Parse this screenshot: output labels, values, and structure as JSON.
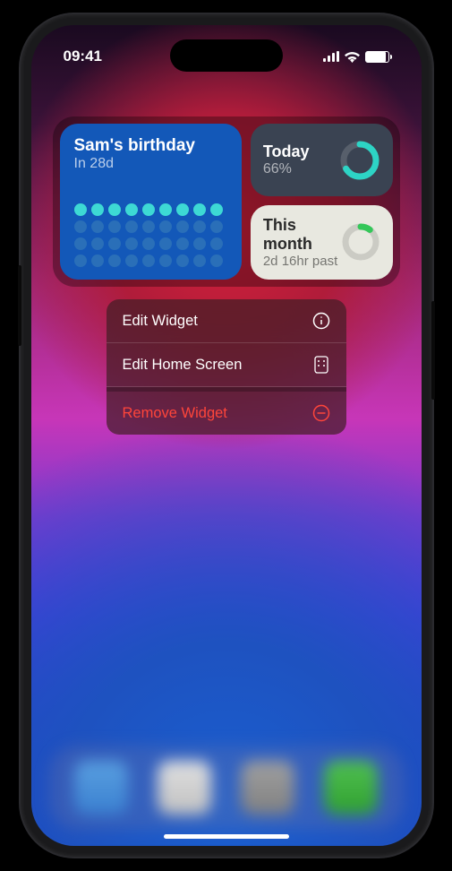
{
  "status": {
    "time": "09:41"
  },
  "widgets": {
    "countdown": {
      "title": "Sam's birthday",
      "subtitle": "In 28d"
    },
    "today": {
      "title": "Today",
      "value": "66%",
      "ring_color": "#2dd4c5",
      "ring_pct": 66
    },
    "month": {
      "title": "This month",
      "value": "2d 16hr past",
      "ring_color": "#34c759",
      "ring_pct": 10
    }
  },
  "menu": {
    "edit_widget": "Edit Widget",
    "edit_home": "Edit Home Screen",
    "remove": "Remove Widget"
  }
}
